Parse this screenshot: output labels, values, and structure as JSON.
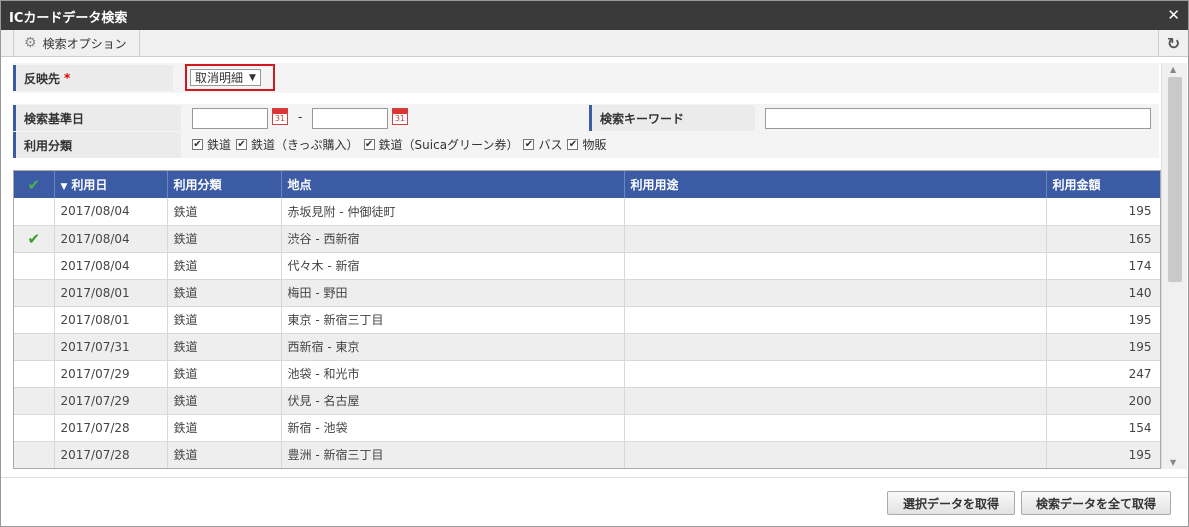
{
  "window": {
    "title": "ICカードデータ検索"
  },
  "toolbar": {
    "option_label": "検索オプション"
  },
  "form": {
    "target_label": "反映先",
    "target_required": "*",
    "target_value": "取消明細",
    "date_label": "検索基準日",
    "date_from": "",
    "date_sep": "-",
    "date_to": "",
    "calendar_day": "31",
    "keyword_label": "検索キーワード",
    "keyword_value": "",
    "category_label": "利用分類",
    "categories": [
      {
        "label": "鉄道",
        "checked": true
      },
      {
        "label": "鉄道（きっぷ購入）",
        "checked": true
      },
      {
        "label": "鉄道（Suicaグリーン券）",
        "checked": true
      },
      {
        "label": "バス",
        "checked": true
      },
      {
        "label": "物販",
        "checked": true
      }
    ]
  },
  "grid": {
    "headers": {
      "check": "✔",
      "date": "利用日",
      "category": "利用分類",
      "place": "地点",
      "purpose": "利用用途",
      "amount": "利用金額"
    },
    "rows": [
      {
        "checked": false,
        "date": "2017/08/04",
        "category": "鉄道",
        "place": "赤坂見附 - 仲御徒町",
        "purpose": "",
        "amount": "195"
      },
      {
        "checked": true,
        "date": "2017/08/04",
        "category": "鉄道",
        "place": "渋谷 - 西新宿",
        "purpose": "",
        "amount": "165"
      },
      {
        "checked": false,
        "date": "2017/08/04",
        "category": "鉄道",
        "place": "代々木 - 新宿",
        "purpose": "",
        "amount": "174"
      },
      {
        "checked": false,
        "date": "2017/08/01",
        "category": "鉄道",
        "place": "梅田 - 野田",
        "purpose": "",
        "amount": "140"
      },
      {
        "checked": false,
        "date": "2017/08/01",
        "category": "鉄道",
        "place": "東京 - 新宿三丁目",
        "purpose": "",
        "amount": "195"
      },
      {
        "checked": false,
        "date": "2017/07/31",
        "category": "鉄道",
        "place": "西新宿 - 東京",
        "purpose": "",
        "amount": "195"
      },
      {
        "checked": false,
        "date": "2017/07/29",
        "category": "鉄道",
        "place": "池袋 - 和光市",
        "purpose": "",
        "amount": "247"
      },
      {
        "checked": false,
        "date": "2017/07/29",
        "category": "鉄道",
        "place": "伏見 - 名古屋",
        "purpose": "",
        "amount": "200"
      },
      {
        "checked": false,
        "date": "2017/07/28",
        "category": "鉄道",
        "place": "新宿 - 池袋",
        "purpose": "",
        "amount": "154"
      },
      {
        "checked": false,
        "date": "2017/07/28",
        "category": "鉄道",
        "place": "豊洲 - 新宿三丁目",
        "purpose": "",
        "amount": "195"
      }
    ]
  },
  "footer": {
    "get_selected_label": "選択データを取得",
    "get_all_label": "検索データを全て取得"
  },
  "colors": {
    "header_blue": "#3b5ba5",
    "highlight_red": "#d0191f",
    "check_green": "#3a9a2a"
  }
}
